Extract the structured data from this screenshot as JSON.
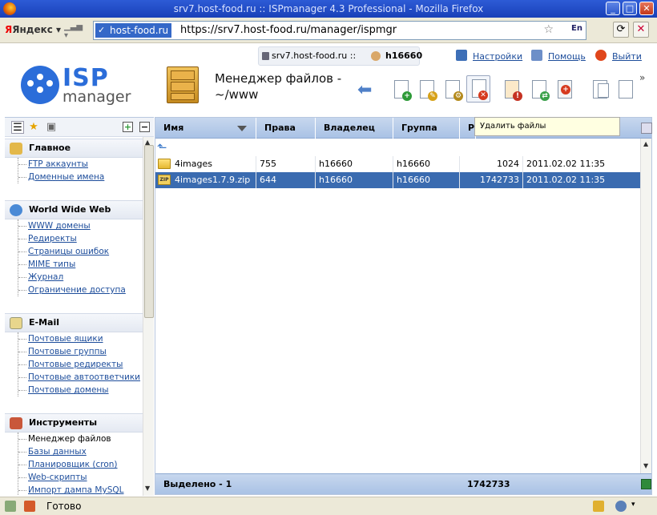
{
  "window": {
    "title": "srv7.host-food.ru :: ISPmanager 4.3 Professional - Mozilla Firefox",
    "minimize": "_",
    "maximize": "□",
    "close": "✕"
  },
  "navbar": {
    "yandex_label": "Яндекс",
    "site_identity": "host-food.ru",
    "url": "https://srv7.host-food.ru/manager/ispmgr",
    "lang": "En"
  },
  "top": {
    "host": "srv7.host-food.ru ::",
    "user": "h16660",
    "settings": "Настройки",
    "help": "Помощь",
    "logout": "Выйти"
  },
  "logo": {
    "isp": "ISP",
    "manager": "manager"
  },
  "page": {
    "title_line1": "Менеджер файлов -",
    "title_line2": "~/www"
  },
  "toolbar": {
    "tooltip": "Удалить файлы",
    "more": "»",
    "icons": [
      "back-arrow-icon",
      "new-file-icon",
      "edit-icon",
      "settings-doc-icon",
      "delete-files-icon",
      "permissions-icon",
      "copy-move-icon",
      "archive-icon",
      "copy-icon",
      "paste-icon"
    ]
  },
  "sidebar": {
    "groups": [
      {
        "title": "Главное",
        "items": [
          "FTP аккаунты",
          "Доменные имена"
        ]
      },
      {
        "title": "World Wide Web",
        "items": [
          "WWW домены",
          "Редиректы",
          "Страницы ошибок",
          "MIME типы",
          "Журнал",
          "Ограничение доступа"
        ]
      },
      {
        "title": "E-Mail",
        "items": [
          "Почтовые ящики",
          "Почтовые группы",
          "Почтовые редиректы",
          "Почтовые автоответчики",
          "Почтовые домены"
        ]
      },
      {
        "title": "Инструменты",
        "items": [
          "Менеджер файлов",
          "Базы данных",
          "Планировщик (cron)",
          "Web-скрипты",
          "Импорт дампа MySQL"
        ]
      }
    ]
  },
  "table": {
    "columns": [
      "Имя",
      "Права",
      "Владелец",
      "Группа",
      "Ра"
    ],
    "rows": [
      {
        "name": "4images",
        "perm": "755",
        "owner": "h16660",
        "group": "h16660",
        "size": "1024",
        "date": "2011.02.02 11:35",
        "type": "folder"
      },
      {
        "name": "4images1.7.9.zip",
        "perm": "644",
        "owner": "h16660",
        "group": "h16660",
        "size": "1742733",
        "date": "2011.02.02 11:35",
        "type": "zip"
      }
    ],
    "footer_label": "Выделено - 1",
    "footer_sum": "1742733"
  },
  "status": {
    "text": "Готово"
  },
  "colors": {
    "accent": "#2b6dd9",
    "selected_row": "#3a6bb0",
    "header": "#a9c2e5"
  }
}
